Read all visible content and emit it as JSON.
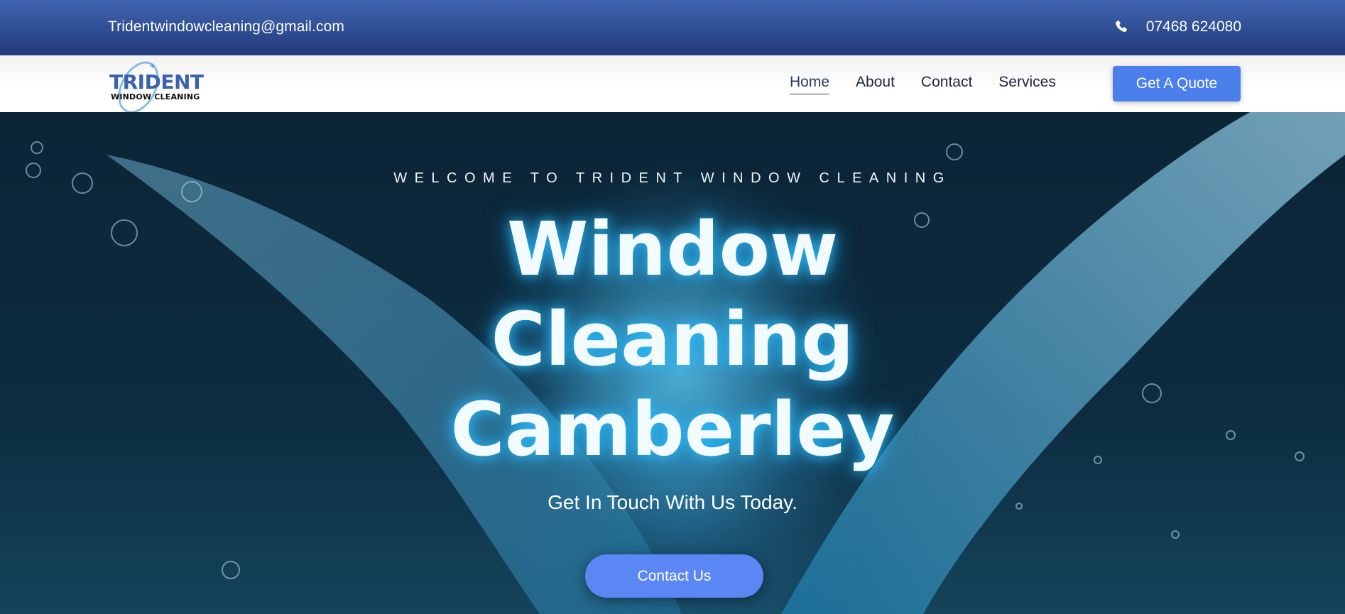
{
  "topbar": {
    "email": "Tridentwindowcleaning@gmail.com",
    "phone_icon": "phone-icon",
    "phone": "07468 624080"
  },
  "nav": {
    "logo": {
      "name": "TRIDENT",
      "subtitle": "WINDOW CLEANING"
    },
    "items": [
      {
        "label": "Home",
        "active": true
      },
      {
        "label": "About",
        "active": false
      },
      {
        "label": "Contact",
        "active": false
      },
      {
        "label": "Services",
        "active": false
      }
    ],
    "cta_label": "Get A Quote"
  },
  "hero": {
    "eyebrow": "WELCOME TO TRIDENT WINDOW CLEANING",
    "headline_lines": [
      "Window",
      "Cleaning",
      "Camberley"
    ],
    "subheading": "Get In Touch With Us Today.",
    "cta_label": "Contact Us"
  },
  "colors": {
    "topbar": "#2f4d93",
    "accent_button": "#4a7fec",
    "contact_button": "#5b87f5",
    "nav_text": "#1d2640",
    "glow": "#28beff"
  }
}
